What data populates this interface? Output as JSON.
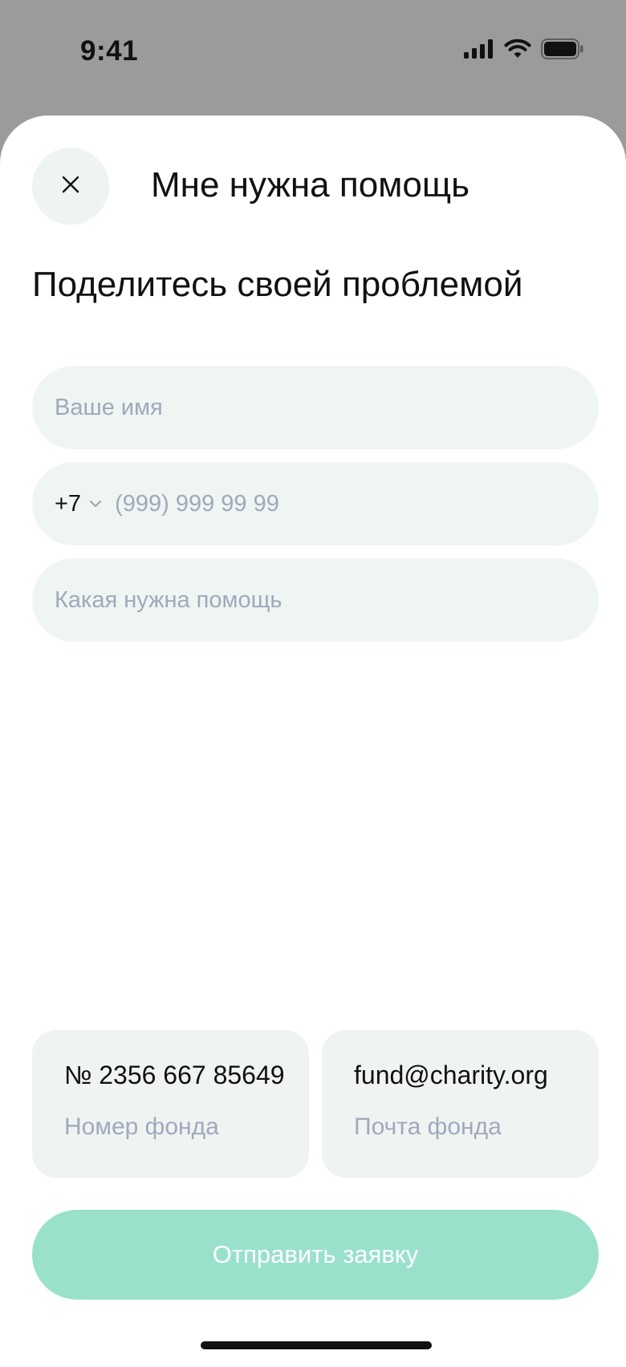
{
  "status_bar": {
    "time": "9:41",
    "icons": [
      "signal-icon",
      "wifi-icon",
      "battery-icon"
    ]
  },
  "header": {
    "title": "Мне нужна помощь",
    "close_icon": "close-icon"
  },
  "form": {
    "heading": "Поделитесь своей проблемой",
    "name_placeholder": "Ваше имя",
    "phone_code": "+7",
    "phone_placeholder": "(999) 999 99 99",
    "help_placeholder": "Какая нужна помощь"
  },
  "info": {
    "fund_number_value": "№ 2356 667 85649",
    "fund_number_label": "Номер фонда",
    "fund_email_value": "fund@charity.org",
    "fund_email_label": "Почта фонда"
  },
  "submit": {
    "label": "Отправить заявку"
  },
  "colors": {
    "accent_disabled": "#9ae1cb",
    "field_background": "#eff5f2",
    "placeholder": "#a0a9bc",
    "outer_background": "#9b9b9b"
  }
}
